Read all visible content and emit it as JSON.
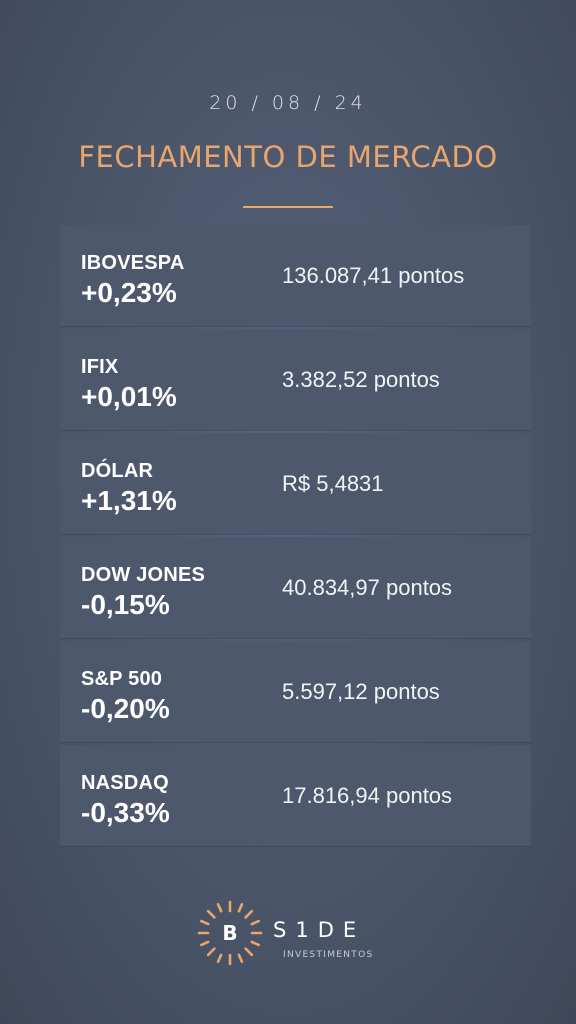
{
  "header": {
    "date": "20 / 08 / 24",
    "title": "FECHAMENTO DE MERCADO"
  },
  "rows": [
    {
      "name": "IBOVESPA",
      "change": "+0,23%",
      "value": "136.087,41 pontos"
    },
    {
      "name": "IFIX",
      "change": "+0,01%",
      "value": "3.382,52 pontos"
    },
    {
      "name": "DÓLAR",
      "change": "+1,31%",
      "value": "R$ 5,4831"
    },
    {
      "name": "DOW JONES",
      "change": "-0,15%",
      "value": "40.834,97 pontos"
    },
    {
      "name": "S&P 500",
      "change": "-0,20%",
      "value": "5.597,12 pontos"
    },
    {
      "name": "NASDAQ",
      "change": "-0,33%",
      "value": "17.816,94 pontos"
    }
  ],
  "logo": {
    "letter": "B",
    "brand": "S1DE",
    "subbrand": "INVESTIMENTOS",
    "icon": "sunburst-icon"
  },
  "colors": {
    "accent": "#e8a56d",
    "background": "#4a5569",
    "row_background": "#4d586c",
    "text": "#ffffff"
  }
}
